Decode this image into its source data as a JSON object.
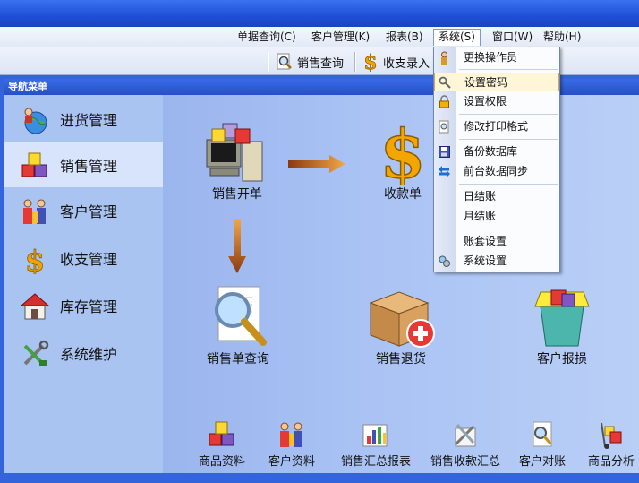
{
  "menubar": {
    "items": [
      "单据查询(C)",
      "客户管理(K)",
      "报表(B)",
      "系统(S)",
      "窗口(W)",
      "帮助(H)"
    ],
    "active_index": 3
  },
  "toolbar": {
    "sales_query": "销售查询",
    "income_expense": "收支录入"
  },
  "sidebar": {
    "header": "导航菜单",
    "items": [
      "进货管理",
      "销售管理",
      "客户管理",
      "收支管理",
      "库存管理",
      "系统维护"
    ],
    "selected_index": 1
  },
  "main": {
    "big": [
      "销售开单",
      "收款单",
      "销售单查询",
      "销售退货",
      "客户报损"
    ],
    "small": [
      "商品资料",
      "客户资料",
      "销售汇总报表",
      "销售收款汇总",
      "客户对账",
      "商品分析"
    ]
  },
  "dropdown": {
    "items": [
      "更换操作员",
      "设置密码",
      "设置权限",
      "修改打印格式",
      "备份数据库",
      "前台数据同步",
      "日结账",
      "月结账",
      "账套设置",
      "系统设置"
    ],
    "highlighted_index": 1
  },
  "colors": {
    "title_blue": "#1f4fd6",
    "sidebar": "#aac4f2",
    "highlight": "#fff6d8"
  }
}
